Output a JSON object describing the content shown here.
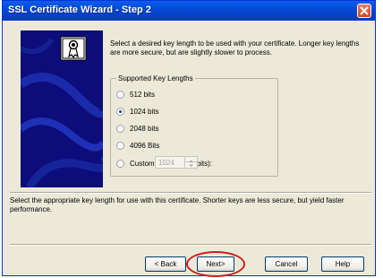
{
  "window": {
    "title": "SSL Certificate Wizard - Step 2"
  },
  "intro_text": "Select a desired key length to be used with your certificate. Longer key lengths are more secure, but are slightly slower to process.",
  "key_lengths": {
    "group_label": "Supported Key Lengths",
    "options": [
      {
        "label": "512 bits",
        "checked": false
      },
      {
        "label": "1024 bits",
        "checked": true
      },
      {
        "label": "2048 bits",
        "checked": false
      },
      {
        "label": "4096 Bits",
        "checked": false
      },
      {
        "label": "Custom Key Size (in bits):",
        "checked": false
      }
    ],
    "custom_value": "1024"
  },
  "bottom_text": "Select the appropriate key length for use with this certificate. Shorter keys are less secure, but yield faster performance.",
  "buttons": {
    "back": "< Back",
    "next": "Next>",
    "cancel": "Cancel",
    "help": "Help"
  },
  "colors": {
    "titlebar": "#0349d6",
    "side_panel": "#0c0c7a",
    "highlight_circle": "#d11b1b",
    "dialog_bg": "#ece9d8"
  },
  "icons": [
    "close-icon",
    "certificate-icon",
    "spin-up-icon",
    "spin-down-icon"
  ]
}
